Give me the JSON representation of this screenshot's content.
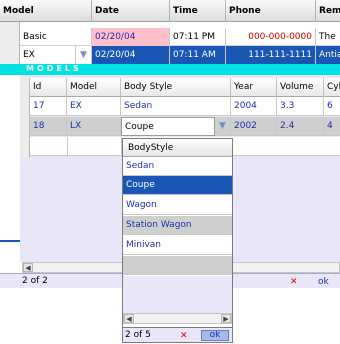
{
  "outer": {
    "columns": [
      "Model",
      "Date",
      "Time",
      "Phone",
      "Rem"
    ],
    "rows": [
      {
        "model": "Basic",
        "date": "02/20/04",
        "time": "07:11 PM",
        "phone": "000-000-0000",
        "rem": "The"
      },
      {
        "model": "EX",
        "date": "02/20/04",
        "time": "07:11 AM",
        "phone": "111-111-1111",
        "rem": "Antia"
      }
    ],
    "status": "2 of 2",
    "cancel_glyph": "✕",
    "ok_label": "ok"
  },
  "models_label": "MODELS",
  "inner": {
    "columns": [
      "Id",
      "Model",
      "Body Style",
      "Year",
      "Volume",
      "Cyl"
    ],
    "rows": [
      {
        "id": "17",
        "model": "EX",
        "body": "Sedan",
        "year": "2004",
        "volume": "3.3",
        "cyl": "6"
      },
      {
        "id": "18",
        "model": "LX",
        "body": "Coupe",
        "year": "2002",
        "volume": "2.4",
        "cyl": "4"
      }
    ]
  },
  "dropdown": {
    "header": "BodyStyle",
    "options": [
      "Sedan",
      "Coupe",
      "Wagon",
      "Station Wagon",
      "Minivan"
    ],
    "selected": "Coupe",
    "status": "2 of 5",
    "cancel_glyph": "✕",
    "ok_label": "ok"
  },
  "colors": {
    "selection": "#1a57b4",
    "models_bar": "#00e2e2",
    "pink": "#ffc0cb"
  }
}
